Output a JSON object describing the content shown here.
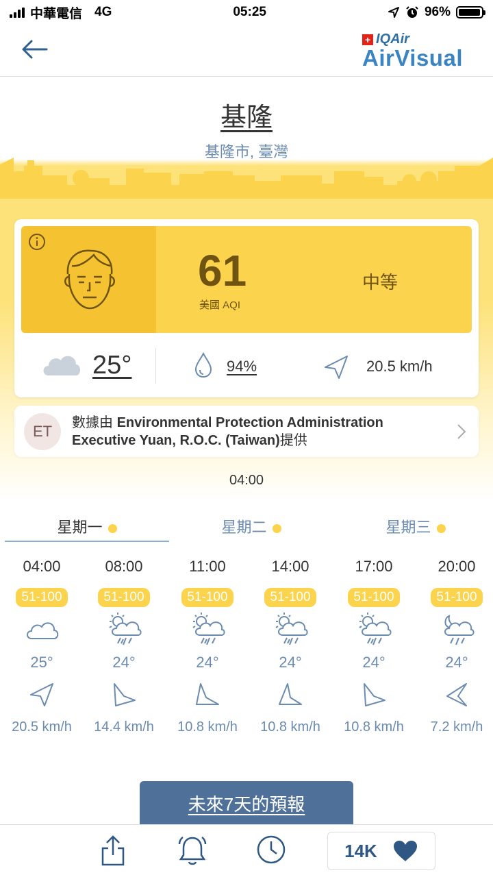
{
  "status_bar": {
    "carrier": "中華電信",
    "network": "4G",
    "time": "05:25",
    "battery": "96%",
    "battery_level": 0.96
  },
  "brand": {
    "top": "IQAir",
    "main": "AirVisual"
  },
  "location": {
    "city": "基隆",
    "region": "基隆市, 臺灣"
  },
  "aqi": {
    "value": "61",
    "unit": "美國 AQI",
    "level": "中等",
    "color": "#fbd34d"
  },
  "weather": {
    "temperature": "25°",
    "humidity": "94%",
    "wind": "20.5 km/h"
  },
  "source": {
    "avatar": "ET",
    "prefix": "數據由 ",
    "name": "Environmental Protection Administration Executive Yuan, R.O.C. (Taiwan)",
    "suffix": "提供"
  },
  "update_time": "04:00",
  "days": [
    {
      "label": "星期一",
      "active": true
    },
    {
      "label": "星期二",
      "active": false
    },
    {
      "label": "星期三",
      "active": false
    }
  ],
  "forecast": [
    {
      "time": "04:00",
      "aqi": "51-100",
      "icon": "cloud-icon",
      "temp": "25°",
      "wind": "20.5 km/h"
    },
    {
      "time": "08:00",
      "aqi": "51-100",
      "icon": "sun-rain-icon",
      "temp": "24°",
      "wind": "14.4 km/h"
    },
    {
      "time": "11:00",
      "aqi": "51-100",
      "icon": "sun-rain-icon",
      "temp": "24°",
      "wind": "10.8 km/h"
    },
    {
      "time": "14:00",
      "aqi": "51-100",
      "icon": "sun-rain-icon",
      "temp": "24°",
      "wind": "10.8 km/h"
    },
    {
      "time": "17:00",
      "aqi": "51-100",
      "icon": "sun-rain-icon",
      "temp": "24°",
      "wind": "10.8 km/h"
    },
    {
      "time": "20:00",
      "aqi": "51-100",
      "icon": "moon-rain-icon",
      "temp": "24°",
      "wind": "7.2 km/h"
    }
  ],
  "forecast_button": "未來7天的預報",
  "bottom": {
    "like_count": "14K"
  }
}
